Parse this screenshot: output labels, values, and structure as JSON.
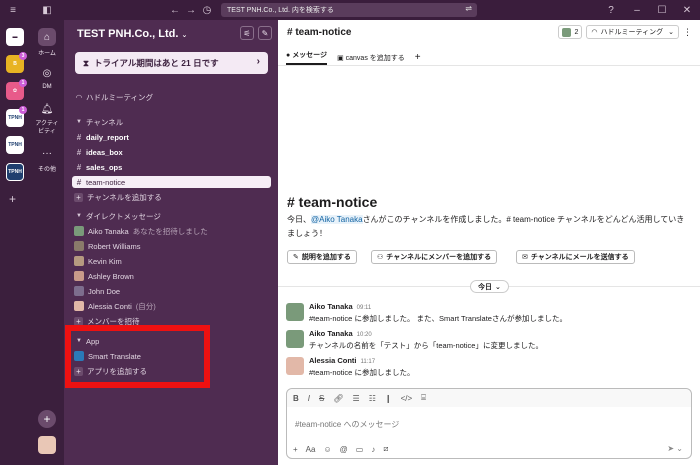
{
  "titlebar": {
    "search_placeholder": "TEST PNH.Co., Ltd. 内を検索する"
  },
  "rail": {
    "workspaces": [
      {
        "label": "",
        "color": "#ffffff"
      },
      {
        "label": "B",
        "color": "#e8b323",
        "badge": "3"
      },
      {
        "label": "",
        "color": "#e85a8a",
        "badge": "1"
      },
      {
        "label": "TPNH",
        "color": "#ffffff",
        "badge": "1"
      },
      {
        "label": "TPNH",
        "color": "#ffffff"
      },
      {
        "label": "TPNH",
        "color": "#1f3f6f"
      }
    ]
  },
  "nav": {
    "home": "ホーム",
    "dm": "DM",
    "activity": "アクティビティ",
    "more": "その他"
  },
  "sidebar": {
    "workspace_name": "TEST PNH.Co., Ltd.",
    "trial_text": "トライアル期間はあと 21 日です",
    "huddle": "ハドルミーティング",
    "channels_header": "チャンネル",
    "channels": [
      "daily_report",
      "ideas_box",
      "sales_ops",
      "team-notice"
    ],
    "add_channel": "チャンネルを追加する",
    "dm_header": "ダイレクトメッセージ",
    "dms": [
      {
        "name": "Aiko Tanaka",
        "note": "あなたを招待しました"
      },
      {
        "name": "Robert Williams",
        "note": ""
      },
      {
        "name": "Kevin Kim",
        "note": ""
      },
      {
        "name": "Ashley Brown",
        "note": ""
      },
      {
        "name": "John Doe",
        "note": ""
      },
      {
        "name": "Alessia Conti",
        "note": "(自分)"
      }
    ],
    "invite_members": "メンバーを招待",
    "app_header": "App",
    "apps": [
      "Smart Translate"
    ],
    "add_app": "アプリを追加する"
  },
  "main": {
    "channel_title": "# team-notice",
    "member_count": "2",
    "huddle_button": "ハドルミーティング",
    "tabs": [
      "メッセージ",
      "canvas を追加する"
    ],
    "intro_title": "# team-notice",
    "intro_prefix": "今日、",
    "intro_mention": "@Aiko Tanaka",
    "intro_suffix": "さんがこのチャンネルを作成しました。# team-notice チャンネルをどんどん活用していきましょう！",
    "actions": [
      "説明を追加する",
      "チャンネルにメンバーを追加する",
      "チャンネルにメールを送信する"
    ],
    "today_label": "今日",
    "messages": [
      {
        "name": "Aiko Tanaka",
        "time": "09:11",
        "text": "#team-notice に参加しました。 また、Smart Translateさんが参加しました。"
      },
      {
        "name": "Aiko Tanaka",
        "time": "10:20",
        "text": "チャンネルの名前を「テスト」から「team-notice」に変更しました。"
      },
      {
        "name": "Alessia Conti",
        "time": "11:17",
        "text": "#team-notice に参加しました。"
      }
    ],
    "composer_placeholder": "#team-notice へのメッセージ"
  }
}
